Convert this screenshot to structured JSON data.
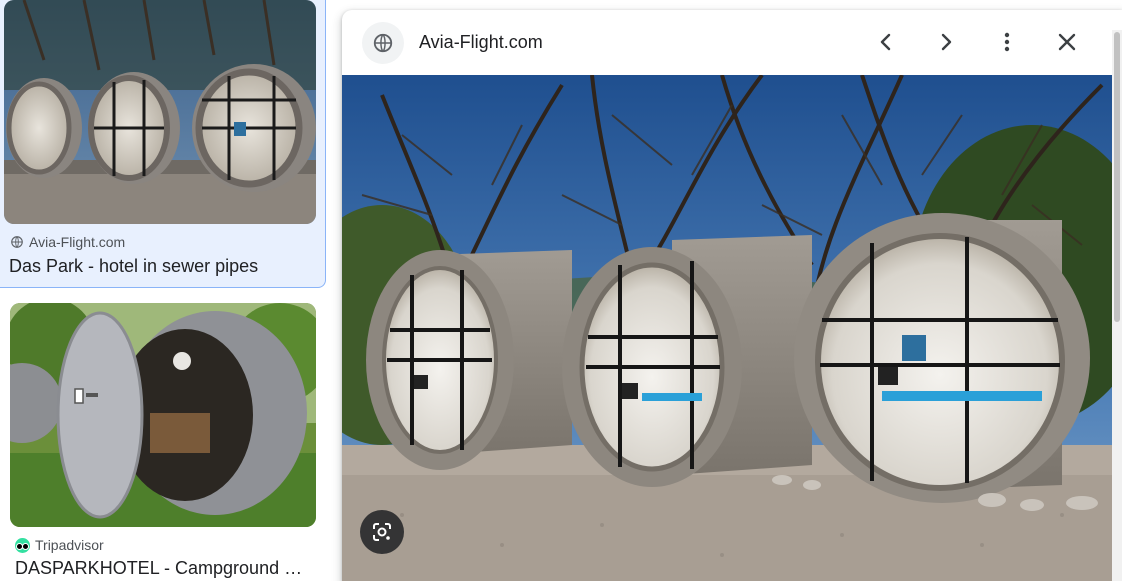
{
  "results": [
    {
      "source": "Avia-Flight.com",
      "source_icon": "globe-icon",
      "title": "Das Park - hotel in sewer pipes",
      "selected": true
    },
    {
      "source": "Tripadvisor",
      "source_icon": "tripadvisor-icon",
      "title": "DASPARKHOTEL - Campground Reviews"
    }
  ],
  "preview": {
    "site_name": "Avia-Flight.com",
    "site_icon": "globe-icon",
    "buttons": [
      "chevron-left-icon",
      "chevron-right-icon",
      "more-vert-icon",
      "close-icon"
    ],
    "lens_button": "google-lens-icon"
  },
  "colors": {
    "selected_bg": "#e8f0fe",
    "selected_border": "#8ab4f8",
    "tripadvisor": "#34e0a1"
  }
}
